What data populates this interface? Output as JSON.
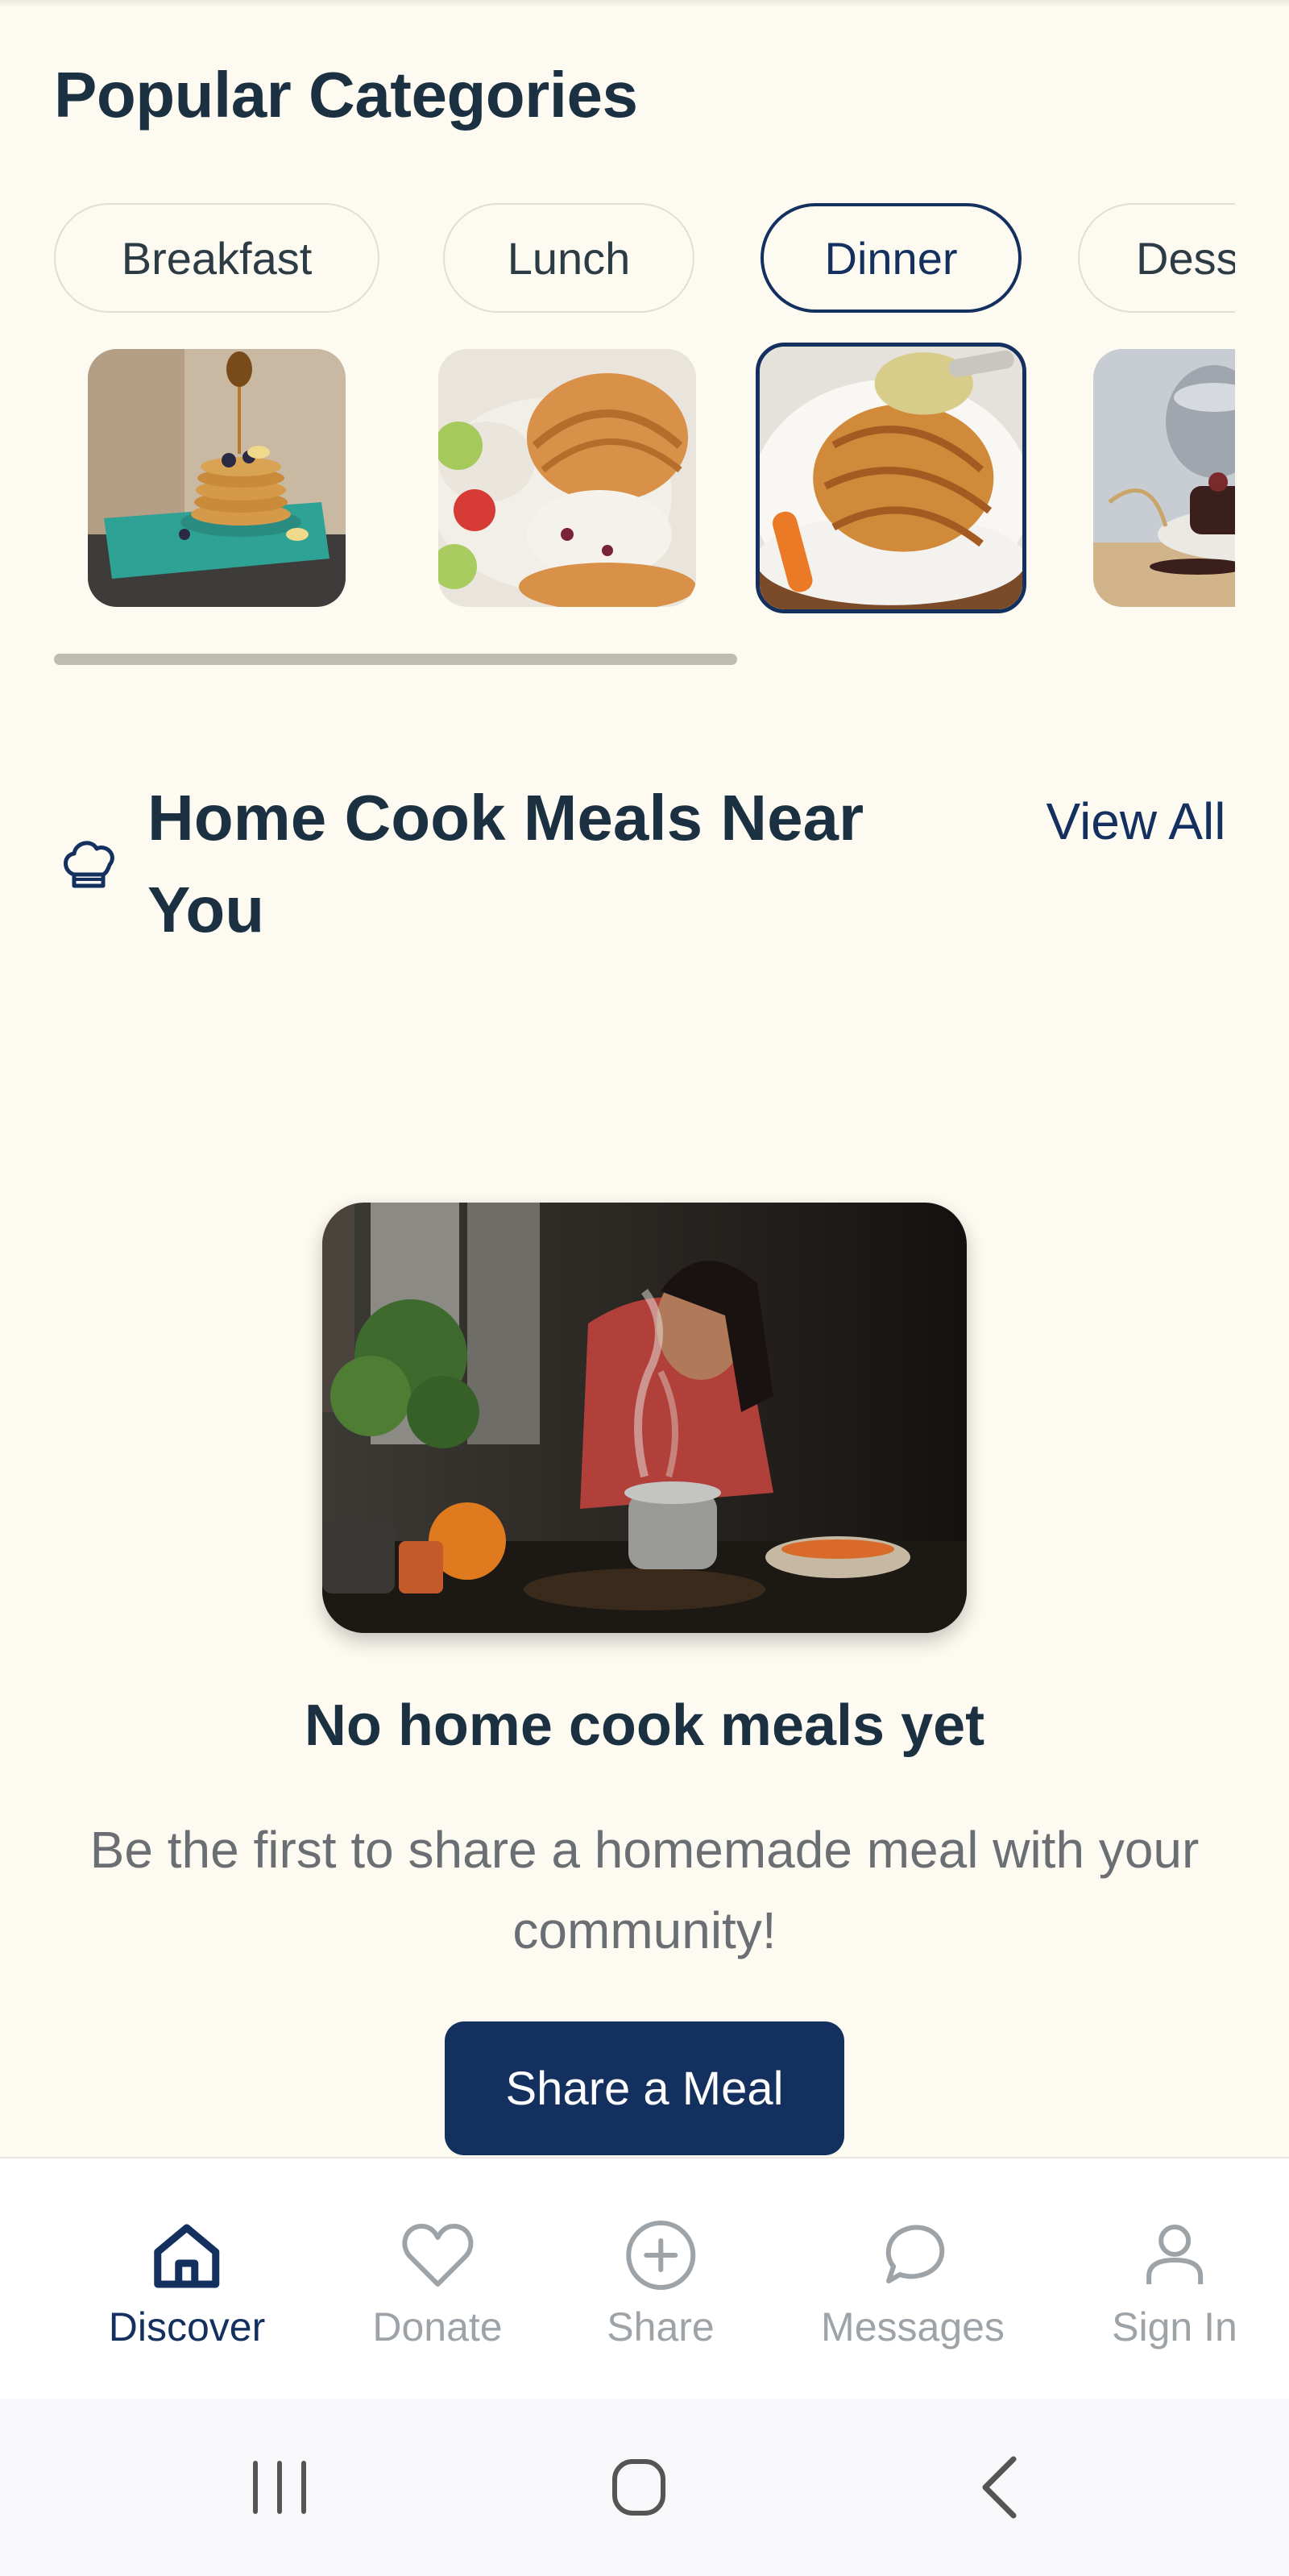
{
  "popular": {
    "title": "Popular Categories",
    "categories": [
      {
        "label": "Breakfast",
        "selected": false
      },
      {
        "label": "Lunch",
        "selected": false
      },
      {
        "label": "Dinner",
        "selected": true
      },
      {
        "label": "Desserts",
        "selected": false
      }
    ]
  },
  "home_cook": {
    "icon": "chef-hat-icon",
    "title": "Home Cook Meals Near You",
    "view_all": "View All"
  },
  "empty_state": {
    "title": "No home cook meals yet",
    "message": "Be the first to share a homemade meal with your community!",
    "cta": "Share a Meal"
  },
  "bottom_nav": {
    "items": [
      {
        "label": "Discover",
        "icon": "home-icon",
        "active": true
      },
      {
        "label": "Donate",
        "icon": "heart-icon",
        "active": false
      },
      {
        "label": "Share",
        "icon": "plus-circle-icon",
        "active": false
      },
      {
        "label": "Messages",
        "icon": "chat-bubble-icon",
        "active": false
      },
      {
        "label": "Sign In",
        "icon": "user-icon",
        "active": false
      }
    ]
  },
  "system_nav": [
    "recent-apps-icon",
    "home-circle-icon",
    "back-icon"
  ],
  "colors": {
    "background": "#fdfaf1",
    "primary": "#13305f",
    "text": "#1b3040",
    "muted": "#9ea3a8"
  }
}
